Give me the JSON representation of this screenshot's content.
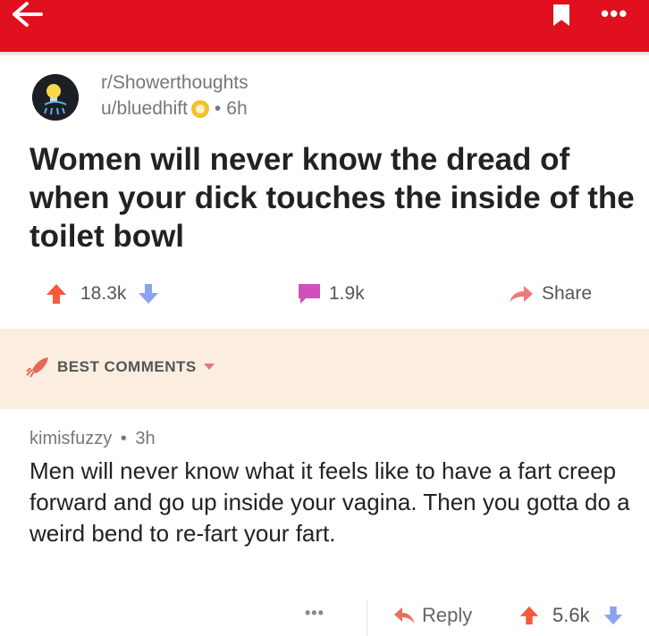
{
  "topbar": {
    "back_icon": "arrow-left-icon",
    "bookmark_icon": "bookmark-icon",
    "more_label": "•••",
    "color": "#e0101e"
  },
  "post": {
    "subreddit": "r/Showerthoughts",
    "author": "u/bluedhift",
    "separator": "•",
    "age": "6h",
    "title": "Women will never know the dread of when your dick touches the inside of the toilet bowl",
    "upvotes": "18.3k",
    "comments": "1.9k",
    "share_label": "Share"
  },
  "best_comments": {
    "label": "BEST COMMENTS",
    "background": "#fbeee0"
  },
  "comment": {
    "author": "kimisfuzzy",
    "separator": "•",
    "age": "3h",
    "text": "Men will never know what it feels like to have a fart creep forward and go up inside your vagina. Then you gotta do a weird bend to re-fart your fart.",
    "more_label": "•••",
    "reply_label": "Reply",
    "score": "5.6k"
  },
  "colors": {
    "upvote": "#f55a3c",
    "downvote": "#8aa2f0",
    "comment_icon": "#d04fb8",
    "share_icon": "#f07a7a",
    "reply_icon": "#e8705c"
  }
}
